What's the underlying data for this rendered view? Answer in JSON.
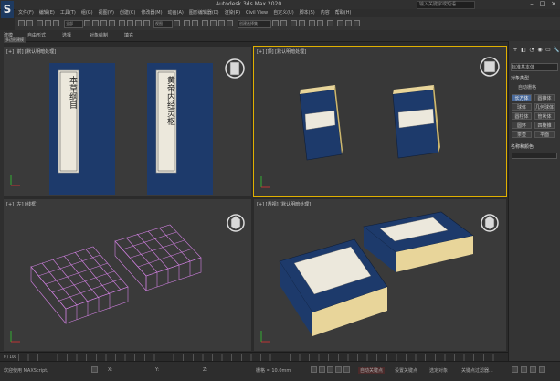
{
  "window": {
    "title": "Autodesk 3ds Max 2020",
    "search_placeholder": "输入关键字或短语",
    "logo": "S",
    "minimize": "–",
    "maximize": "□",
    "close": "×"
  },
  "menu": {
    "items": [
      "文件(F)",
      "编辑(E)",
      "工具(T)",
      "组(G)",
      "视图(V)",
      "创建(C)",
      "修改器(M)",
      "动画(A)",
      "图形编辑器(D)",
      "渲染(R)",
      "Civil View",
      "自定义(U)",
      "脚本(S)",
      "内容",
      "帮助(H)"
    ]
  },
  "toolbar": {
    "selection_filter": "全部",
    "coord_system": "视图",
    "named_selection": "创建选择集"
  },
  "ribbon": {
    "tabs": [
      "建模",
      "自由形式",
      "选择",
      "对象绘制",
      "填充"
    ],
    "active_sub": "多边形建模"
  },
  "viewports": [
    {
      "label": "[+] [前] [默认明暗处理]",
      "name": "front"
    },
    {
      "label": "[+] [顶] [默认明暗处理]",
      "name": "top"
    },
    {
      "label": "[+] [左] [线框]",
      "name": "left"
    },
    {
      "label": "[+] [透视] [默认明暗处理]",
      "name": "perspective"
    }
  ],
  "books": {
    "title_left": "本草纲目",
    "title_right": "黄帝内经灵枢"
  },
  "command_panel": {
    "tabs": [
      "+",
      "◧",
      "◔",
      "◉",
      "▭",
      "🔧"
    ],
    "category": "标准基本体",
    "section": "对象类型",
    "autogrid": "自动栅格",
    "buttons": [
      "长方体",
      "圆锥体",
      "球体",
      "几何球体",
      "圆柱体",
      "管状体",
      "圆环",
      "四棱锥",
      "茶壶",
      "平面"
    ],
    "name_color": "名称和颜色"
  },
  "timeline": {
    "frame_display": "0 / 100",
    "ticks": [
      "0",
      "10",
      "20",
      "30",
      "40",
      "50",
      "60",
      "70",
      "80",
      "90",
      "100"
    ]
  },
  "status": {
    "welcome": "欢迎使用 MAXScript。",
    "x": "X:",
    "y": "Y:",
    "z": "Z:",
    "grid": "栅格 = 10.0mm",
    "auto_key": "自动关键点",
    "set_key": "设置关键点",
    "selected": "选定对象",
    "key_filter": "关键点过滤器..."
  },
  "colors": {
    "book_cover": "#1d3a6b",
    "book_pages": "#e8d59a",
    "wireframe": "#d080e0",
    "active_border": "#e0b000"
  }
}
